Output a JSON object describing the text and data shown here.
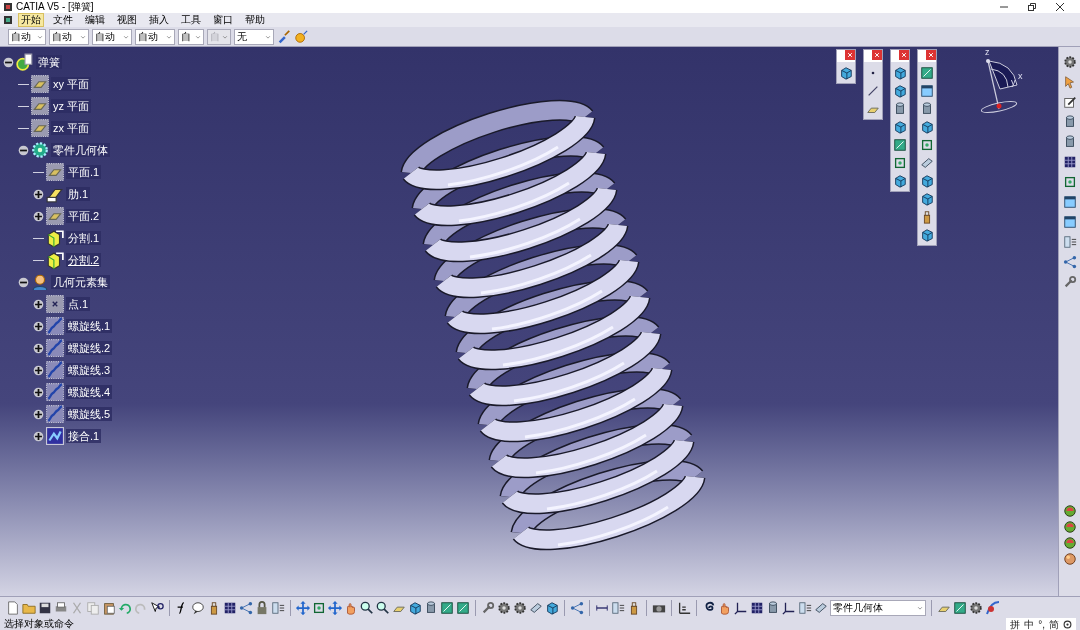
{
  "window": {
    "title": "CATIA V5 - [弹簧]"
  },
  "menu": [
    {
      "label": "开始",
      "selected": true
    },
    {
      "label": "文件",
      "selected": false
    },
    {
      "label": "编辑",
      "selected": false
    },
    {
      "label": "视图",
      "selected": false
    },
    {
      "label": "插入",
      "selected": false
    },
    {
      "label": "工具",
      "selected": false
    },
    {
      "label": "窗口",
      "selected": false
    },
    {
      "label": "帮助",
      "selected": false
    }
  ],
  "graphic_properties": [
    {
      "value": "自动",
      "disabled": false
    },
    {
      "value": "自动",
      "disabled": false
    },
    {
      "value": "自动",
      "disabled": false
    },
    {
      "value": "自动",
      "disabled": false
    },
    {
      "value": "自",
      "disabled": false
    },
    {
      "value": "自",
      "disabled": true
    },
    {
      "value": "无",
      "disabled": false
    }
  ],
  "tree": {
    "label": "弹簧",
    "kind": "part",
    "expanded": true,
    "underlined": false,
    "children": [
      {
        "label": "xy 平面",
        "kind": "plane",
        "underlined": false
      },
      {
        "label": "yz 平面",
        "kind": "plane",
        "underlined": false
      },
      {
        "label": "zx 平面",
        "kind": "plane",
        "underlined": false
      },
      {
        "label": "零件几何体",
        "kind": "body",
        "expanded": true,
        "underlined": false,
        "children": [
          {
            "label": "平面.1",
            "kind": "plane",
            "underlined": false
          },
          {
            "label": "肋.1",
            "kind": "rib",
            "expanded": false,
            "underlined": false
          },
          {
            "label": "平面.2",
            "kind": "plane",
            "expanded": false,
            "underlined": false
          },
          {
            "label": "分割.1",
            "kind": "split",
            "underlined": false
          },
          {
            "label": "分割.2",
            "kind": "split",
            "underlined": true
          }
        ]
      },
      {
        "label": "几何元素集",
        "kind": "geoset",
        "expanded": true,
        "underlined": false,
        "children": [
          {
            "label": "点.1",
            "kind": "point",
            "expanded": false,
            "underlined": false
          },
          {
            "label": "螺旋线.1",
            "kind": "helix",
            "expanded": false,
            "underlined": false
          },
          {
            "label": "螺旋线.2",
            "kind": "helix",
            "expanded": false,
            "underlined": false
          },
          {
            "label": "螺旋线.3",
            "kind": "helix",
            "expanded": false,
            "underlined": false
          },
          {
            "label": "螺旋线.4",
            "kind": "helix",
            "expanded": false,
            "underlined": false
          },
          {
            "label": "螺旋线.5",
            "kind": "helix",
            "expanded": false,
            "underlined": false
          },
          {
            "label": "接合.1",
            "kind": "join",
            "expanded": false,
            "underlined": false
          }
        ]
      }
    ]
  },
  "compass": {
    "axes": [
      "z",
      "x",
      "y"
    ]
  },
  "current_body": {
    "value": "零件几何体"
  },
  "status_bar": {
    "message": "选择对象或命令"
  },
  "ime_bar": [
    "拼",
    "中",
    "°,",
    "简"
  ]
}
